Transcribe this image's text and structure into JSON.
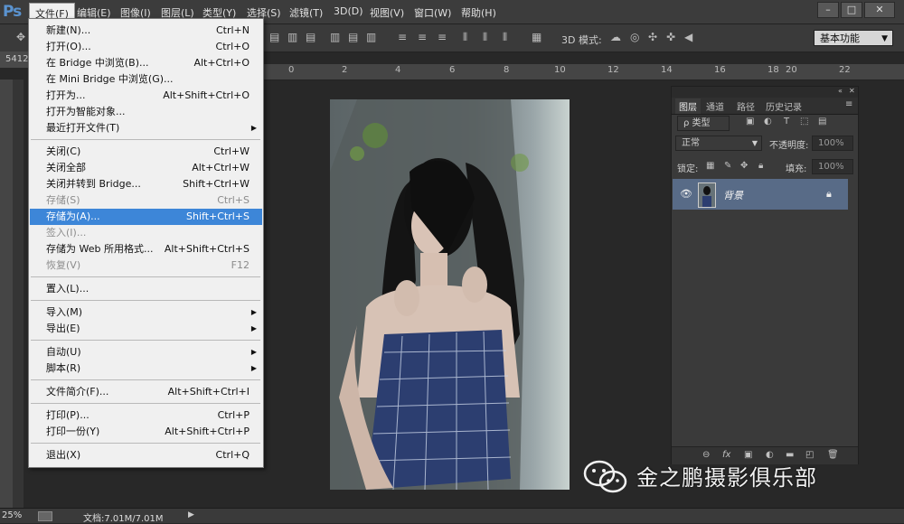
{
  "app": {
    "logo": "Ps"
  },
  "menubar": {
    "items": [
      "文件(F)",
      "编辑(E)",
      "图像(I)",
      "图层(L)",
      "类型(Y)",
      "选择(S)",
      "滤镜(T)",
      "3D(D)",
      "视图(V)",
      "窗口(W)",
      "帮助(H)"
    ],
    "active_index": 0
  },
  "window_controls": [
    "–",
    "□",
    "✕"
  ],
  "options_bar": {
    "mode_3d_label": "3D 模式:",
    "workspace": "基本功能"
  },
  "document": {
    "info_fragment": "5412"
  },
  "ruler": {
    "top_ticks": [
      "0",
      "2",
      "4",
      "6",
      "8",
      "10",
      "12",
      "14",
      "16",
      "18",
      "20",
      "22"
    ]
  },
  "file_menu": {
    "items": [
      {
        "label": "新建(N)...",
        "shortcut": "Ctrl+N"
      },
      {
        "label": "打开(O)...",
        "shortcut": "Ctrl+O"
      },
      {
        "label": "在 Bridge 中浏览(B)...",
        "shortcut": "Alt+Ctrl+O"
      },
      {
        "label": "在 Mini Bridge 中浏览(G)...",
        "shortcut": ""
      },
      {
        "label": "打开为...",
        "shortcut": "Alt+Shift+Ctrl+O"
      },
      {
        "label": "打开为智能对象...",
        "shortcut": ""
      },
      {
        "label": "最近打开文件(T)",
        "shortcut": "",
        "submenu": true
      },
      {
        "separator": true
      },
      {
        "label": "关闭(C)",
        "shortcut": "Ctrl+W"
      },
      {
        "label": "关闭全部",
        "shortcut": "Alt+Ctrl+W"
      },
      {
        "label": "关闭并转到 Bridge...",
        "shortcut": "Shift+Ctrl+W"
      },
      {
        "label": "存储(S)",
        "shortcut": "Ctrl+S",
        "disabled": true
      },
      {
        "label": "存储为(A)...",
        "shortcut": "Shift+Ctrl+S",
        "highlight": true
      },
      {
        "label": "签入(I)...",
        "shortcut": "",
        "disabled": true
      },
      {
        "label": "存储为 Web 所用格式...",
        "shortcut": "Alt+Shift+Ctrl+S"
      },
      {
        "label": "恢复(V)",
        "shortcut": "F12",
        "disabled": true
      },
      {
        "separator": true
      },
      {
        "label": "置入(L)...",
        "shortcut": ""
      },
      {
        "separator": true
      },
      {
        "label": "导入(M)",
        "shortcut": "",
        "submenu": true
      },
      {
        "label": "导出(E)",
        "shortcut": "",
        "submenu": true
      },
      {
        "separator": true
      },
      {
        "label": "自动(U)",
        "shortcut": "",
        "submenu": true
      },
      {
        "label": "脚本(R)",
        "shortcut": "",
        "submenu": true
      },
      {
        "separator": true
      },
      {
        "label": "文件简介(F)...",
        "shortcut": "Alt+Shift+Ctrl+I"
      },
      {
        "separator": true
      },
      {
        "label": "打印(P)...",
        "shortcut": "Ctrl+P"
      },
      {
        "label": "打印一份(Y)",
        "shortcut": "Alt+Shift+Ctrl+P"
      },
      {
        "separator": true
      },
      {
        "label": "退出(X)",
        "shortcut": "Ctrl+Q"
      }
    ]
  },
  "layers_panel": {
    "tabs": [
      "图层",
      "通道",
      "路径",
      "历史记录"
    ],
    "filter_label": "ρ 类型",
    "blend_mode": "正常",
    "opacity_label": "不透明度:",
    "opacity_value": "100%",
    "lock_label": "锁定:",
    "fill_label": "填充:",
    "fill_value": "100%",
    "layer_name": "背景"
  },
  "status": {
    "zoom": "25%",
    "doc_size": "文档:7.01M/7.01M"
  },
  "watermark": {
    "text": "金之鹏摄影俱乐部"
  },
  "colors": {
    "highlight": "#3d86d8",
    "layer_selected": "#586b87",
    "logo": "#5a93d0"
  }
}
